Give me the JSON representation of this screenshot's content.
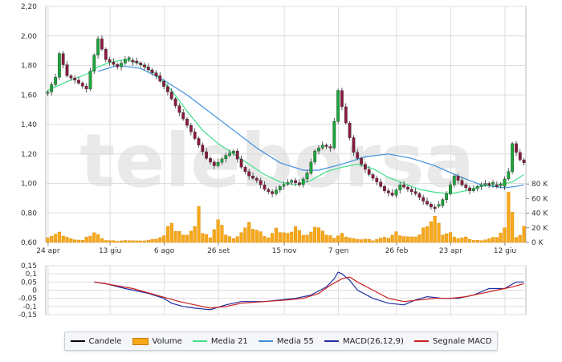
{
  "chart_data": [
    {
      "type": "candlestick",
      "ylim": [
        0.6,
        2.2
      ],
      "y_ticks": [
        "2,20",
        "2,00",
        "1,80",
        "1,60",
        "1,40",
        "1,20",
        "1,00",
        "0,80",
        "0,60"
      ],
      "x_ticks": [
        "24 apr",
        "13 giu",
        "6 ago",
        "26 set",
        "15 nov",
        "7 gen",
        "26 feb",
        "23 apr",
        "12 giu"
      ],
      "volume_ticks": [
        "80 K",
        "60 K",
        "40 K",
        "20 K",
        "0 K"
      ],
      "volume_ylim": [
        0,
        100
      ],
      "price_anchors": [
        [
          0,
          1.62
        ],
        [
          2,
          1.72
        ],
        [
          3,
          1.88
        ],
        [
          5,
          1.73
        ],
        [
          7,
          1.7
        ],
        [
          10,
          1.64
        ],
        [
          11,
          1.76
        ],
        [
          13,
          1.98
        ],
        [
          15,
          1.84
        ],
        [
          18,
          1.79
        ],
        [
          20,
          1.84
        ],
        [
          22,
          1.83
        ],
        [
          25,
          1.79
        ],
        [
          28,
          1.73
        ],
        [
          31,
          1.62
        ],
        [
          34,
          1.48
        ],
        [
          37,
          1.35
        ],
        [
          39,
          1.26
        ],
        [
          41,
          1.17
        ],
        [
          43,
          1.12
        ],
        [
          46,
          1.19
        ],
        [
          48,
          1.22
        ],
        [
          50,
          1.11
        ],
        [
          52,
          1.05
        ],
        [
          54,
          1.02
        ],
        [
          56,
          0.96
        ],
        [
          58,
          0.93
        ],
        [
          60,
          0.98
        ],
        [
          63,
          1.02
        ],
        [
          65,
          0.99
        ],
        [
          67,
          1.07
        ],
        [
          69,
          1.22
        ],
        [
          71,
          1.26
        ],
        [
          73,
          1.24
        ],
        [
          74,
          1.42
        ],
        [
          75,
          1.63
        ],
        [
          77,
          1.41
        ],
        [
          79,
          1.21
        ],
        [
          81,
          1.13
        ],
        [
          83,
          1.06
        ],
        [
          85,
          1.01
        ],
        [
          87,
          0.95
        ],
        [
          89,
          0.92
        ],
        [
          91,
          0.99
        ],
        [
          93,
          0.96
        ],
        [
          95,
          0.93
        ],
        [
          97,
          0.88
        ],
        [
          99,
          0.84
        ],
        [
          101,
          0.85
        ],
        [
          103,
          0.93
        ],
        [
          105,
          1.05
        ],
        [
          107,
          0.99
        ],
        [
          109,
          0.95
        ],
        [
          111,
          0.98
        ],
        [
          113,
          1.0
        ],
        [
          115,
          0.99
        ],
        [
          117,
          0.98
        ],
        [
          119,
          1.08
        ],
        [
          120,
          1.27
        ],
        [
          121,
          1.21
        ],
        [
          122,
          1.16
        ],
        [
          123,
          1.14
        ]
      ],
      "volume_anchors": [
        [
          0,
          8
        ],
        [
          3,
          13
        ],
        [
          6,
          5
        ],
        [
          9,
          3
        ],
        [
          12,
          14
        ],
        [
          15,
          3
        ],
        [
          18,
          2
        ],
        [
          21,
          3
        ],
        [
          24,
          2
        ],
        [
          27,
          4
        ],
        [
          30,
          9
        ],
        [
          32,
          31
        ],
        [
          33,
          16
        ],
        [
          36,
          11
        ],
        [
          38,
          20
        ],
        [
          39,
          58
        ],
        [
          40,
          13
        ],
        [
          42,
          8
        ],
        [
          44,
          31
        ],
        [
          46,
          12
        ],
        [
          48,
          5
        ],
        [
          52,
          25
        ],
        [
          55,
          14
        ],
        [
          57,
          7
        ],
        [
          59,
          18
        ],
        [
          62,
          12
        ],
        [
          64,
          24
        ],
        [
          66,
          9
        ],
        [
          68,
          15
        ],
        [
          70,
          25
        ],
        [
          72,
          10
        ],
        [
          74,
          7
        ],
        [
          76,
          12
        ],
        [
          78,
          7
        ],
        [
          80,
          4
        ],
        [
          82,
          5
        ],
        [
          84,
          3
        ],
        [
          86,
          6
        ],
        [
          88,
          7
        ],
        [
          90,
          14
        ],
        [
          92,
          9
        ],
        [
          94,
          7
        ],
        [
          96,
          11
        ],
        [
          98,
          27
        ],
        [
          100,
          36
        ],
        [
          102,
          12
        ],
        [
          104,
          13
        ],
        [
          106,
          6
        ],
        [
          108,
          7
        ],
        [
          110,
          3
        ],
        [
          112,
          3
        ],
        [
          114,
          5
        ],
        [
          116,
          8
        ],
        [
          118,
          19
        ],
        [
          119,
          86
        ],
        [
          120,
          46
        ],
        [
          121,
          7
        ],
        [
          122,
          9
        ],
        [
          123,
          26
        ]
      ],
      "ma21": [
        [
          0,
          1.63
        ],
        [
          5,
          1.69
        ],
        [
          10,
          1.74
        ],
        [
          13,
          1.79
        ],
        [
          16,
          1.82
        ],
        [
          20,
          1.84
        ],
        [
          24,
          1.81
        ],
        [
          28,
          1.74
        ],
        [
          32,
          1.63
        ],
        [
          36,
          1.49
        ],
        [
          40,
          1.36
        ],
        [
          44,
          1.27
        ],
        [
          48,
          1.2
        ],
        [
          52,
          1.13
        ],
        [
          56,
          1.06
        ],
        [
          60,
          1.01
        ],
        [
          64,
          0.99
        ],
        [
          68,
          1.02
        ],
        [
          72,
          1.08
        ],
        [
          76,
          1.11
        ],
        [
          80,
          1.13
        ],
        [
          84,
          1.1
        ],
        [
          88,
          1.04
        ],
        [
          92,
          1.0
        ],
        [
          96,
          0.96
        ],
        [
          100,
          0.94
        ],
        [
          104,
          0.93
        ],
        [
          108,
          0.95
        ],
        [
          112,
          0.98
        ],
        [
          116,
          0.99
        ],
        [
          120,
          1.01
        ],
        [
          123,
          1.06
        ]
      ],
      "ma55": [
        [
          13,
          1.76
        ],
        [
          18,
          1.8
        ],
        [
          24,
          1.78
        ],
        [
          30,
          1.7
        ],
        [
          36,
          1.6
        ],
        [
          42,
          1.48
        ],
        [
          48,
          1.36
        ],
        [
          54,
          1.24
        ],
        [
          60,
          1.14
        ],
        [
          66,
          1.09
        ],
        [
          70,
          1.09
        ],
        [
          76,
          1.13
        ],
        [
          82,
          1.18
        ],
        [
          88,
          1.2
        ],
        [
          94,
          1.17
        ],
        [
          100,
          1.12
        ],
        [
          106,
          1.05
        ],
        [
          112,
          0.99
        ],
        [
          118,
          0.97
        ],
        [
          121,
          0.98
        ],
        [
          123,
          0.99
        ]
      ]
    },
    {
      "type": "line",
      "ylim": [
        -0.15,
        0.15
      ],
      "y_ticks": [
        "0,15",
        "0,1",
        "0,05",
        "0",
        "-0,05",
        "-0,1",
        "-0,15"
      ],
      "series": [
        {
          "name": "MACD(26,12,9)",
          "color": "#1f2fa3",
          "points": [
            [
              12,
              0.05
            ],
            [
              15,
              0.04
            ],
            [
              20,
              0.01
            ],
            [
              26,
              -0.02
            ],
            [
              30,
              -0.05
            ],
            [
              32,
              -0.08
            ],
            [
              35,
              -0.1
            ],
            [
              38,
              -0.11
            ],
            [
              42,
              -0.12
            ],
            [
              46,
              -0.09
            ],
            [
              50,
              -0.07
            ],
            [
              56,
              -0.07
            ],
            [
              60,
              -0.06
            ],
            [
              64,
              -0.05
            ],
            [
              68,
              -0.03
            ],
            [
              72,
              0.02
            ],
            [
              74,
              0.07
            ],
            [
              75,
              0.11
            ],
            [
              76,
              0.1
            ],
            [
              78,
              0.06
            ],
            [
              80,
              0.0
            ],
            [
              84,
              -0.05
            ],
            [
              88,
              -0.08
            ],
            [
              92,
              -0.09
            ],
            [
              95,
              -0.06
            ],
            [
              98,
              -0.04
            ],
            [
              102,
              -0.05
            ],
            [
              106,
              -0.05
            ],
            [
              110,
              -0.03
            ],
            [
              114,
              0.01
            ],
            [
              118,
              0.01
            ],
            [
              121,
              0.05
            ],
            [
              123,
              0.05
            ]
          ]
        },
        {
          "name": "Segnale MACD",
          "color": "#cc1e1e",
          "points": [
            [
              12,
              0.05
            ],
            [
              16,
              0.035
            ],
            [
              22,
              0.01
            ],
            [
              28,
              -0.03
            ],
            [
              34,
              -0.07
            ],
            [
              38,
              -0.09
            ],
            [
              42,
              -0.11
            ],
            [
              46,
              -0.1
            ],
            [
              50,
              -0.08
            ],
            [
              56,
              -0.07
            ],
            [
              62,
              -0.06
            ],
            [
              66,
              -0.05
            ],
            [
              70,
              -0.02
            ],
            [
              73,
              0.03
            ],
            [
              76,
              0.07
            ],
            [
              78,
              0.08
            ],
            [
              80,
              0.05
            ],
            [
              84,
              0.0
            ],
            [
              88,
              -0.05
            ],
            [
              92,
              -0.07
            ],
            [
              96,
              -0.06
            ],
            [
              100,
              -0.05
            ],
            [
              104,
              -0.05
            ],
            [
              108,
              -0.04
            ],
            [
              112,
              -0.02
            ],
            [
              116,
              0.0
            ],
            [
              120,
              0.02
            ],
            [
              123,
              0.04
            ]
          ]
        }
      ]
    }
  ],
  "legend": [
    {
      "label": "Candele",
      "color": "#000000",
      "kind": "line"
    },
    {
      "label": "Volume",
      "color": "#f7a81b",
      "kind": "box"
    },
    {
      "label": "Media 21",
      "color": "#3fe08a",
      "kind": "line"
    },
    {
      "label": "Media 55",
      "color": "#3f8fe0",
      "kind": "line"
    },
    {
      "label": "MACD(26,12,9)",
      "color": "#1f2fa3",
      "kind": "line"
    },
    {
      "label": "Segnale MACD",
      "color": "#cc1e1e",
      "kind": "line"
    }
  ],
  "watermark": "teleborsa",
  "colors": {
    "candle_up": "#1aa83a",
    "candle_down": "#8b1a3e",
    "volume": "#f7a81b",
    "grid": "#dddddd"
  }
}
